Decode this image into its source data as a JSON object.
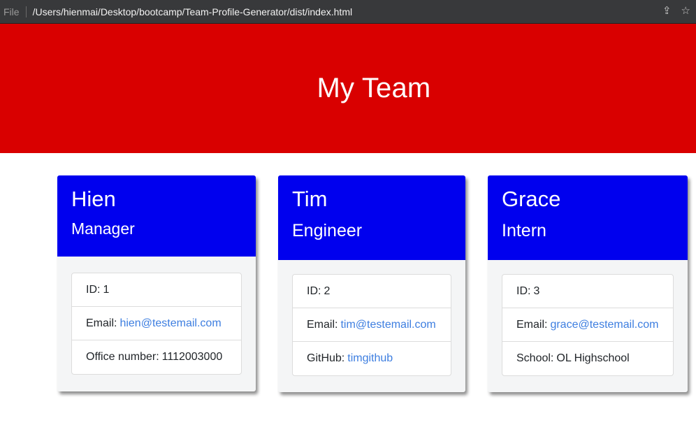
{
  "browser": {
    "file_label": "File",
    "url": "/Users/hienmai/Desktop/bootcamp/Team-Profile-Generator/dist/index.html",
    "icons": [
      "share-icon",
      "bookmark-star-icon"
    ]
  },
  "header": {
    "title": "My Team"
  },
  "colors": {
    "header_bg": "#d90000",
    "card_header_bg": "#0000ee",
    "link": "#3d7ee0"
  },
  "cards": [
    {
      "name": "Hien",
      "role": "Manager",
      "items": [
        {
          "label": "ID:",
          "value": "1"
        },
        {
          "label": "Email:",
          "value": "hien@testemail.com"
        },
        {
          "label": "Office number:",
          "value": "1112003000"
        }
      ]
    },
    {
      "name": "Tim",
      "role": "Engineer",
      "items": [
        {
          "label": "ID:",
          "value": "2"
        },
        {
          "label": "Email:",
          "value": "tim@testemail.com"
        },
        {
          "label": "GitHub:",
          "value": "timgithub"
        }
      ]
    },
    {
      "name": "Grace",
      "role": "Intern",
      "items": [
        {
          "label": "ID:",
          "value": "3"
        },
        {
          "label": "Email:",
          "value": "grace@testemail.com"
        },
        {
          "label": "School:",
          "value": "OL Highschool"
        }
      ]
    }
  ]
}
